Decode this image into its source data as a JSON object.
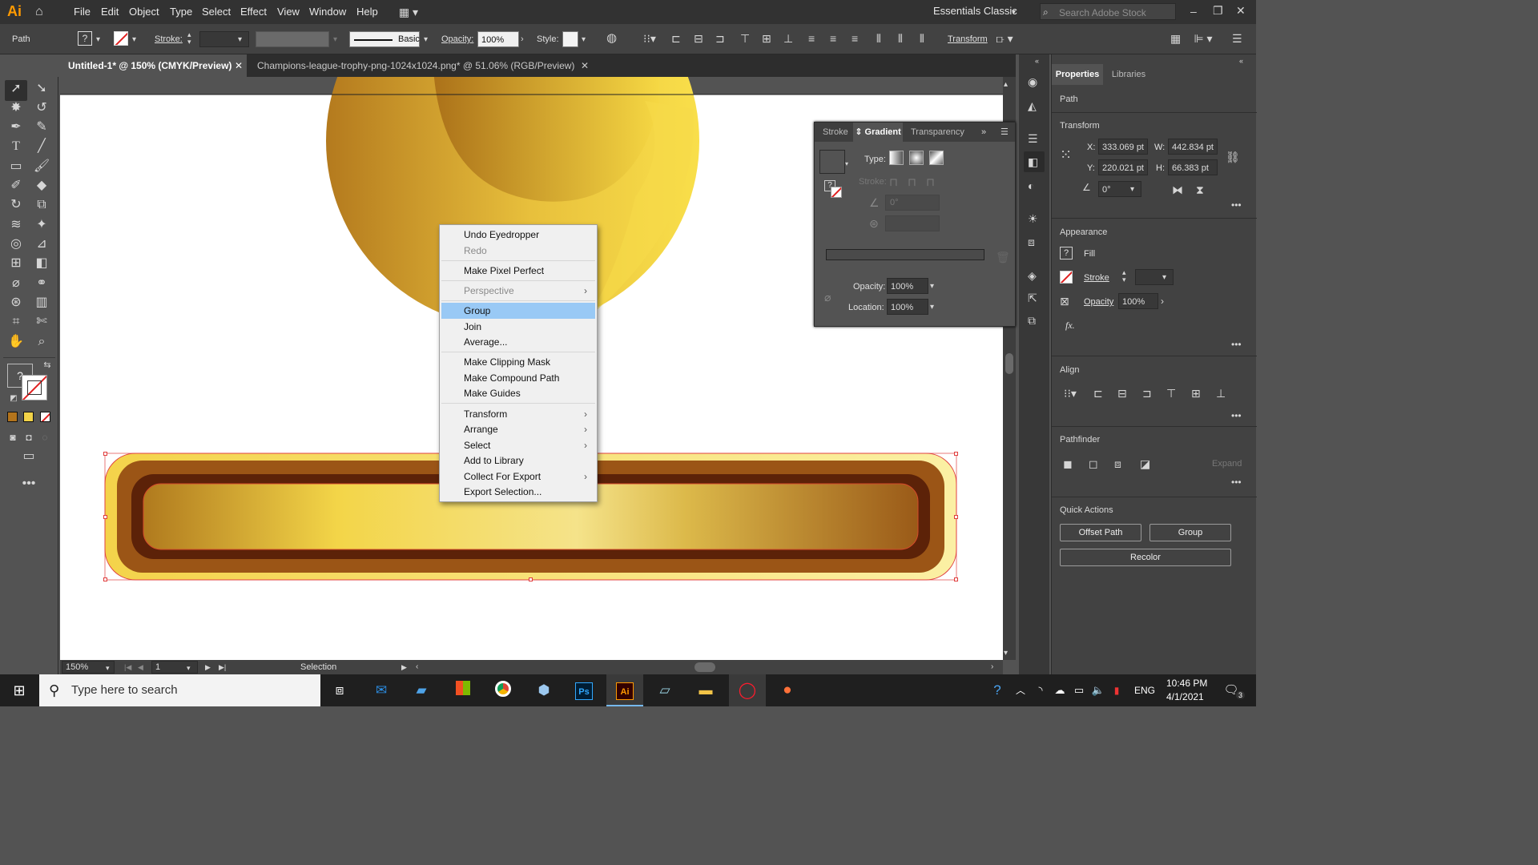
{
  "app": {
    "logo": "Ai",
    "menu": [
      "File",
      "Edit",
      "Object",
      "Type",
      "Select",
      "Effect",
      "View",
      "Window",
      "Help"
    ],
    "workspace": "Essentials Classic",
    "search_placeholder": "Search Adobe Stock"
  },
  "control_bar": {
    "selection_type": "Path",
    "stroke_label": "Stroke:",
    "brush_label": "Basic",
    "opacity_label": "Opacity:",
    "opacity_value": "100%",
    "style_label": "Style:",
    "transform_label": "Transform"
  },
  "tabs": [
    {
      "label": "Untitled-1* @ 150% (CMYK/Preview)",
      "active": true
    },
    {
      "label": "Champions-league-trophy-png-1024x1024.png* @ 51.06% (RGB/Preview)",
      "active": false
    }
  ],
  "status_bar": {
    "zoom": "150%",
    "artboard": "1",
    "tool": "Selection"
  },
  "context_menu": {
    "items": [
      {
        "label": "Undo Eyedropper",
        "disabled": false
      },
      {
        "label": "Redo",
        "disabled": true
      },
      {
        "label": "Make Pixel Perfect",
        "disabled": false
      },
      {
        "label": "Perspective",
        "disabled": true,
        "submenu": true
      },
      {
        "label": "Group",
        "highlighted": true
      },
      {
        "label": "Join"
      },
      {
        "label": "Average..."
      },
      {
        "label": "Make Clipping Mask"
      },
      {
        "label": "Make Compound Path"
      },
      {
        "label": "Make Guides"
      },
      {
        "label": "Transform",
        "submenu": true
      },
      {
        "label": "Arrange",
        "submenu": true
      },
      {
        "label": "Select",
        "submenu": true
      },
      {
        "label": "Add to Library"
      },
      {
        "label": "Collect For Export",
        "submenu": true
      },
      {
        "label": "Export Selection..."
      }
    ]
  },
  "gradient_panel": {
    "tabs": [
      "Stroke",
      "Gradient",
      "Transparency"
    ],
    "type_label": "Type:",
    "stroke_label": "Stroke:",
    "angle_value": "0°",
    "opacity_label": "Opacity:",
    "opacity_value": "100%",
    "location_label": "Location:",
    "location_value": "100%"
  },
  "properties": {
    "tabs": [
      "Properties",
      "Libraries"
    ],
    "selection": "Path",
    "transform_title": "Transform",
    "x_label": "X:",
    "x": "333.069 pt",
    "y_label": "Y:",
    "y": "220.021 pt",
    "w_label": "W:",
    "w": "442.834 pt",
    "h_label": "H:",
    "h": "66.383 pt",
    "rotate": "0°",
    "appearance_title": "Appearance",
    "fill_label": "Fill",
    "stroke_label": "Stroke",
    "opacity_label": "Opacity",
    "opacity_value": "100%",
    "fx_label": "fx.",
    "align_title": "Align",
    "pathfinder_title": "Pathfinder",
    "expand_label": "Expand",
    "quick_actions_title": "Quick Actions",
    "offset_path_label": "Offset Path",
    "group_label": "Group",
    "recolor_label": "Recolor"
  },
  "taskbar": {
    "search_placeholder": "Type here to search",
    "language": "ENG",
    "time": "10:46 PM",
    "date": "4/1/2021",
    "notifications": "3"
  },
  "colors": {
    "accent": "#99c9f5",
    "gold_light": "#f9df4a",
    "gold_dark": "#b87d1c",
    "brown": "#8a4a13",
    "dark_brown": "#5a1f07"
  }
}
